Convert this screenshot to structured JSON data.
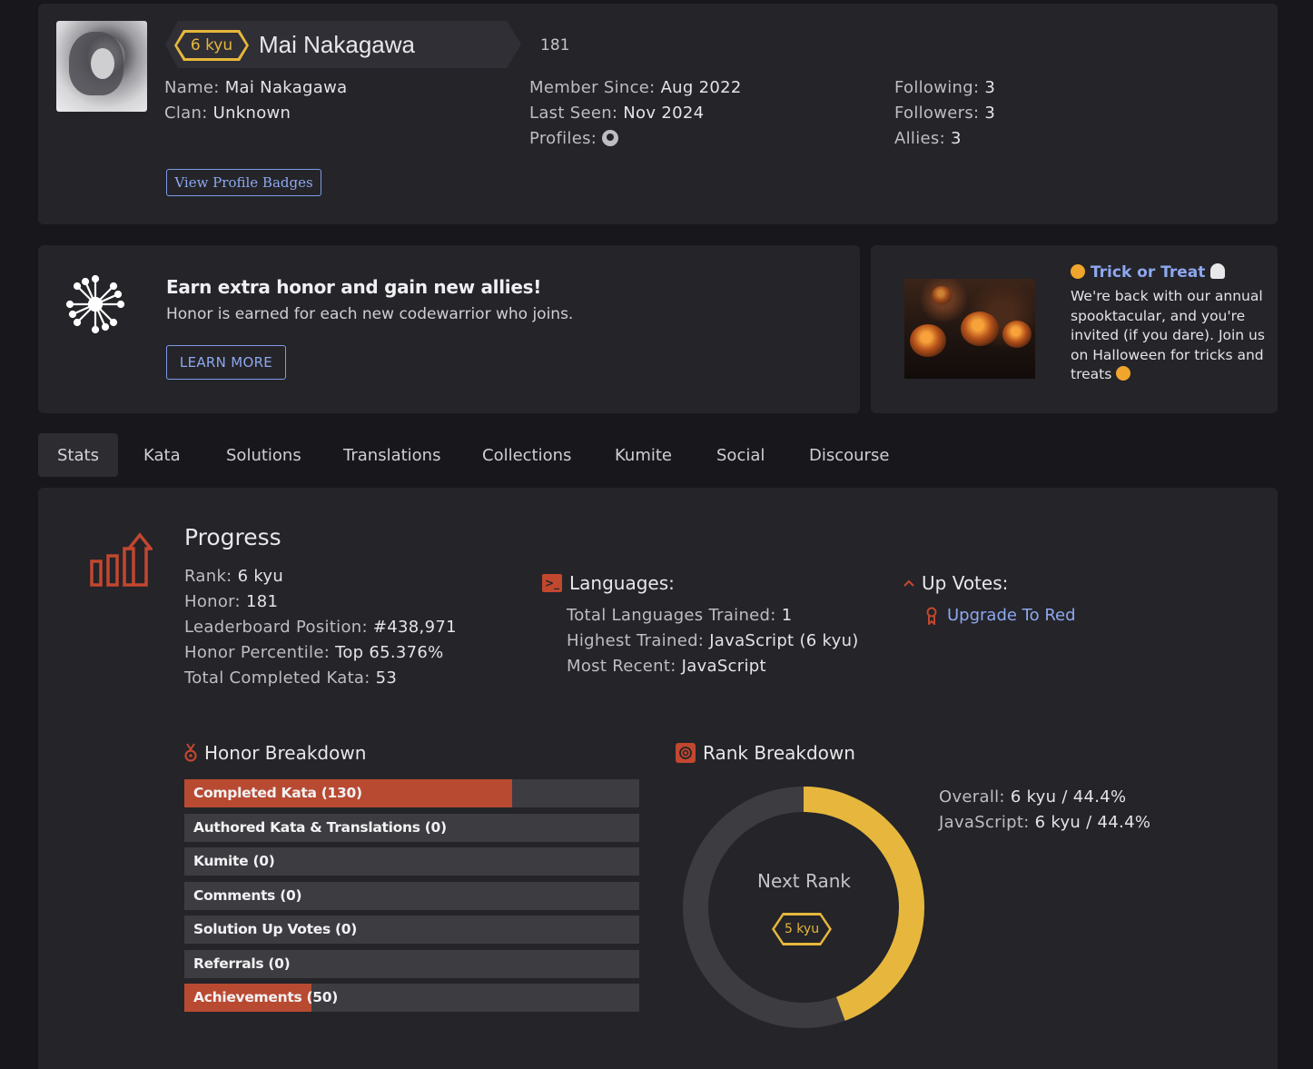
{
  "profile": {
    "rank_badge": "6 kyu",
    "display_name": "Mai Nakagawa",
    "honor": "181",
    "name_label": "Name:",
    "name_value": "Mai Nakagawa",
    "clan_label": "Clan:",
    "clan_value": "Unknown",
    "member_since_label": "Member Since:",
    "member_since_value": "Aug 2022",
    "last_seen_label": "Last Seen:",
    "last_seen_value": "Nov 2024",
    "profiles_label": "Profiles:",
    "following_label": "Following:",
    "following_value": "3",
    "followers_label": "Followers:",
    "followers_value": "3",
    "allies_label": "Allies:",
    "allies_value": "3",
    "badges_button": "View Profile Badges"
  },
  "promo": {
    "title": "Earn extra honor and gain new allies!",
    "text": "Honor is earned for each new codewarrior who joins.",
    "button": "LEARN MORE"
  },
  "event": {
    "title": "Trick or Treat",
    "text": "We're back with our annual spooktacular, and you're invited (if you dare). Join us on Halloween for tricks and treats"
  },
  "tabs": [
    "Stats",
    "Kata",
    "Solutions",
    "Translations",
    "Collections",
    "Kumite",
    "Social",
    "Discourse"
  ],
  "progress": {
    "heading": "Progress",
    "rank_label": "Rank:",
    "rank_value": "6 kyu",
    "honor_label": "Honor:",
    "honor_value": "181",
    "leaderboard_label": "Leaderboard Position:",
    "leaderboard_value": "#438,971",
    "percentile_label": "Honor Percentile:",
    "percentile_value": "Top 65.376%",
    "completed_label": "Total Completed Kata:",
    "completed_value": "53"
  },
  "languages": {
    "heading": "Languages:",
    "total_label": "Total Languages Trained:",
    "total_value": "1",
    "highest_label": "Highest Trained:",
    "highest_value": "JavaScript (6 kyu)",
    "recent_label": "Most Recent:",
    "recent_value": "JavaScript"
  },
  "upvotes": {
    "heading": "Up Votes:",
    "link": "Upgrade To Red"
  },
  "honor_breakdown": {
    "heading": "Honor Breakdown",
    "accent": "#b84a32",
    "items": [
      {
        "label": "Completed Kata (130)",
        "fill": 0.72
      },
      {
        "label": "Authored Kata & Translations (0)",
        "fill": 0
      },
      {
        "label": "Kumite (0)",
        "fill": 0
      },
      {
        "label": "Comments (0)",
        "fill": 0
      },
      {
        "label": "Solution Up Votes (0)",
        "fill": 0
      },
      {
        "label": "Referrals (0)",
        "fill": 0
      },
      {
        "label": "Achievements (50)",
        "fill": 0.28
      }
    ]
  },
  "rank_breakdown": {
    "heading": "Rank Breakdown",
    "progress": 0.444,
    "progress_color": "#e6b73c",
    "next_rank_label": "Next Rank",
    "next_rank_badge": "5 kyu",
    "overall_label": "Overall:",
    "overall_value": "6 kyu / 44.4%",
    "js_label": "JavaScript:",
    "js_value": "6 kyu / 44.4%"
  }
}
